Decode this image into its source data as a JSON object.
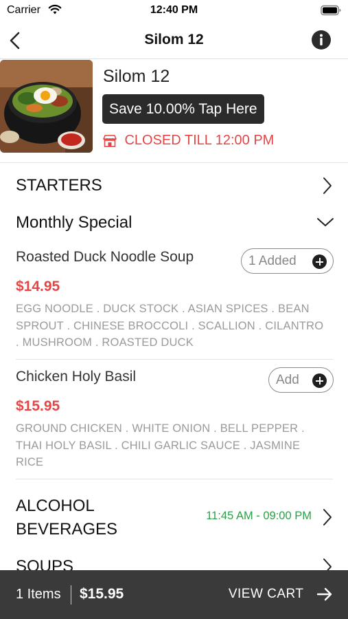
{
  "status_bar": {
    "carrier": "Carrier",
    "time": "12:40 PM",
    "icons": [
      "wifi-icon",
      "battery-icon"
    ]
  },
  "nav": {
    "title": "Silom 12",
    "icons": [
      "chevron-left-icon",
      "info-icon"
    ]
  },
  "restaurant": {
    "name": "Silom 12",
    "discount_label": "Save 10.00% Tap Here",
    "status_text": "CLOSED TILL 12:00 PM",
    "status_icon": "store-icon"
  },
  "categories": [
    {
      "title": "STARTERS",
      "chevron": "chevron-right-icon"
    },
    {
      "title": "Monthly Special",
      "chevron": "chevron-down-icon"
    }
  ],
  "items": [
    {
      "name": "Roasted Duck Noodle Soup",
      "price": "$14.95",
      "description": "EGG NOODLE . DUCK STOCK . ASIAN SPICES . BEAN SPROUT . CHINESE BROCCOLI . SCALLION . CILANTRO . MUSHROOM . ROASTED DUCK",
      "button_label": "1 Added"
    },
    {
      "name": "Chicken Holy Basil",
      "price": "$15.95",
      "description": "GROUND CHICKEN . WHITE ONION . BELL PEPPER . THAI HOLY BASIL . CHILI GARLIC SAUCE . JASMINE RICE",
      "button_label": "Add"
    }
  ],
  "alcohol": {
    "title": "ALCOHOL BEVERAGES",
    "hours": "11:45 AM - 09:00 PM"
  },
  "next_category": {
    "title": "SOUPS"
  },
  "cart": {
    "count": "1 Items",
    "total": "$15.95",
    "view_label": "VIEW CART"
  },
  "colors": {
    "price_red": "#e64545",
    "hours_green": "#2aa146",
    "cart_bar": "#3a3a3a"
  }
}
